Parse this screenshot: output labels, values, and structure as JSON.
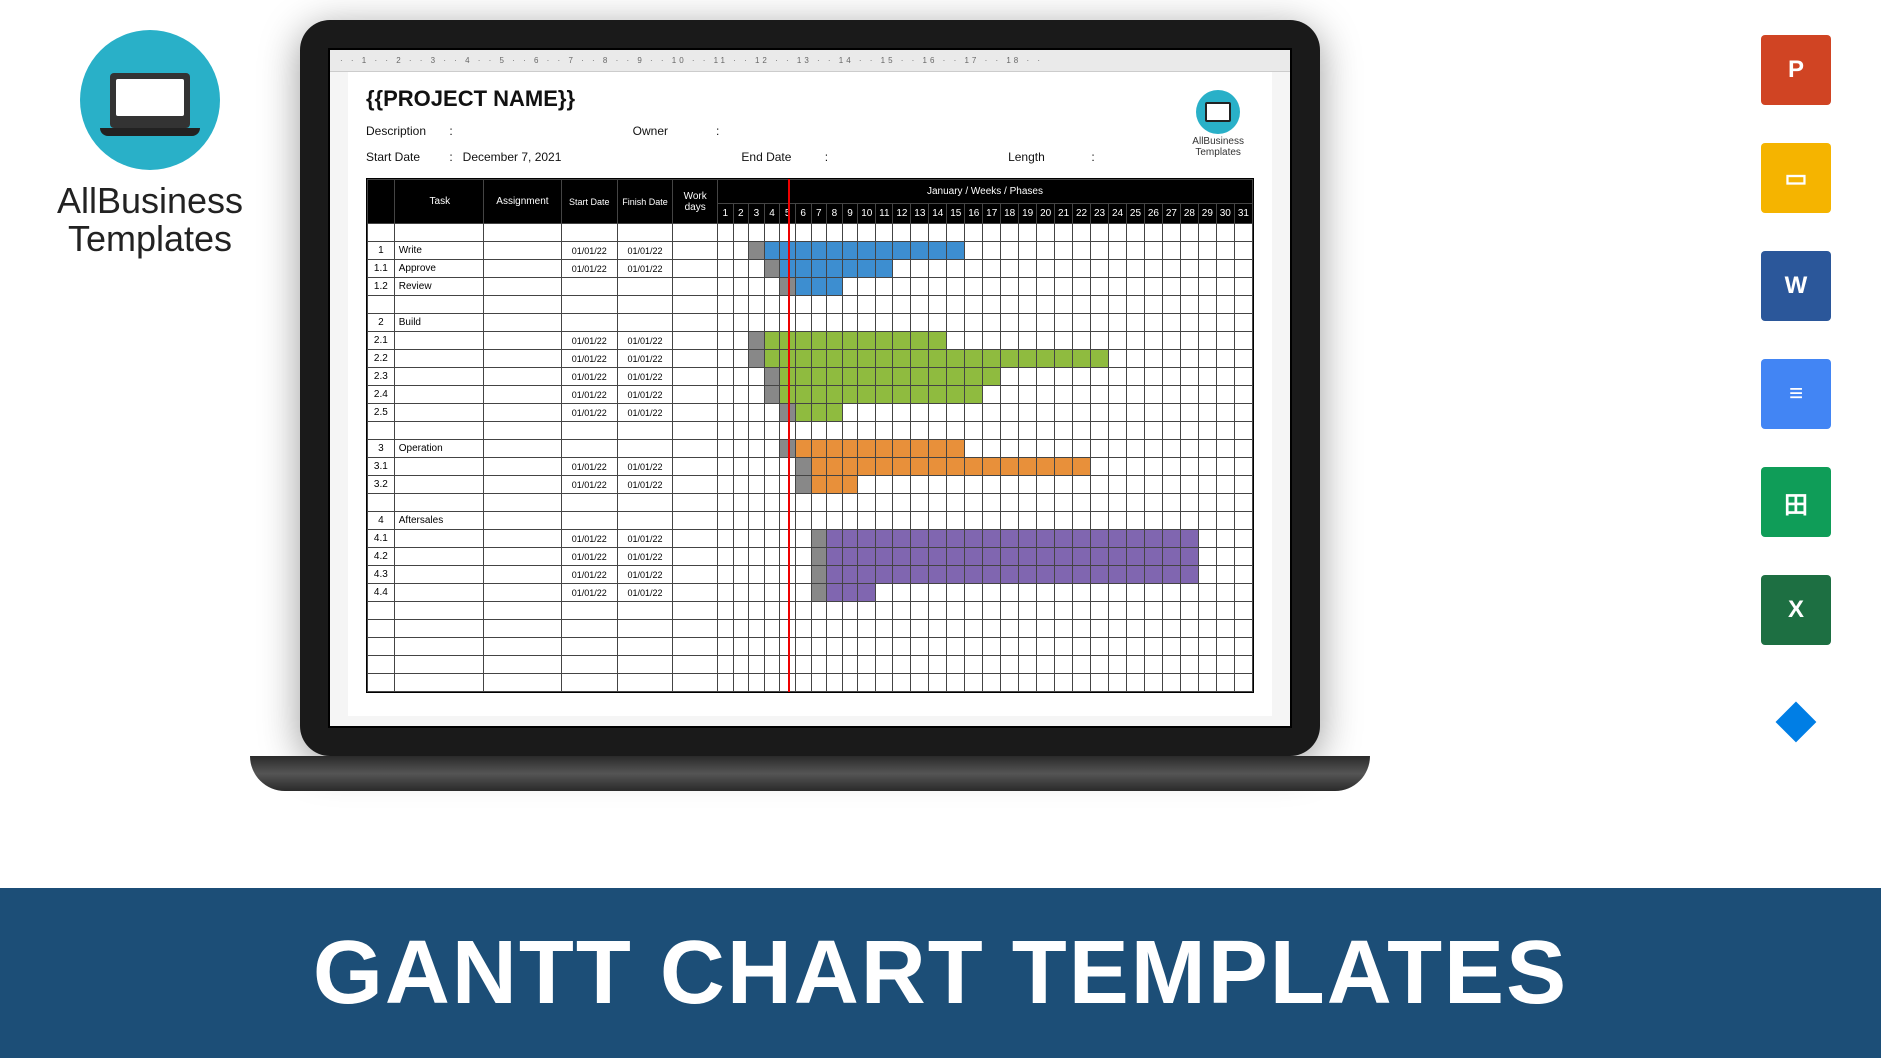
{
  "brand": {
    "line1": "AllBusiness",
    "line2": "Templates"
  },
  "icons": {
    "powerpoint": "P",
    "slides": "▭",
    "word": "W",
    "docs": "≡",
    "sheets": "田",
    "excel": "X",
    "dropbox": "⬥"
  },
  "doc": {
    "title": "{{PROJECT NAME}}",
    "desc_label": "Description",
    "owner_label": "Owner",
    "start_label": "Start Date",
    "start_value": "December 7, 2021",
    "end_label": "End Date",
    "length_label": "Length",
    "watermark": "AllBusiness\nTemplates"
  },
  "headers": {
    "task": "Task",
    "assignment": "Assignment",
    "start": "Start Date",
    "finish": "Finish Date",
    "work": "Work days",
    "timeline": "January / Weeks / Phases"
  },
  "banner": "GANTT CHART TEMPLATES",
  "today": 7,
  "chart_data": {
    "type": "gantt",
    "title": "{{PROJECT NAME}}",
    "xlabel": "January / Weeks / Phases",
    "x_range": [
      1,
      31
    ],
    "today_marker": 7,
    "color_legend": {
      "Write": "#3d8ed0",
      "Build": "#8fbb3f",
      "Operation": "#e8903a",
      "Aftersales": "#8066b0",
      "lead": "#888"
    },
    "rows": [
      {
        "id": "",
        "task": "",
        "start_date": "",
        "finish_date": "",
        "bar": null
      },
      {
        "id": "1",
        "task": "Write",
        "start_date": "01/01/22",
        "finish_date": "01/01/22",
        "bar": {
          "color": "blue",
          "start": 4,
          "end": 15,
          "lead": 1
        }
      },
      {
        "id": "1.1",
        "task": "Approve",
        "start_date": "01/01/22",
        "finish_date": "01/01/22",
        "bar": {
          "color": "blue",
          "start": 5,
          "end": 11,
          "lead": 1
        }
      },
      {
        "id": "1.2",
        "task": "Review",
        "start_date": "",
        "finish_date": "",
        "bar": {
          "color": "blue",
          "start": 6,
          "end": 8,
          "lead": 1
        }
      },
      {
        "id": "",
        "task": "",
        "start_date": "",
        "finish_date": "",
        "bar": null
      },
      {
        "id": "2",
        "task": "Build",
        "start_date": "",
        "finish_date": "",
        "bar": null
      },
      {
        "id": "2.1",
        "task": "",
        "start_date": "01/01/22",
        "finish_date": "01/01/22",
        "bar": {
          "color": "green",
          "start": 4,
          "end": 14,
          "lead": 1
        }
      },
      {
        "id": "2.2",
        "task": "",
        "start_date": "01/01/22",
        "finish_date": "01/01/22",
        "bar": {
          "color": "green",
          "start": 4,
          "end": 23,
          "lead": 1
        }
      },
      {
        "id": "2.3",
        "task": "",
        "start_date": "01/01/22",
        "finish_date": "01/01/22",
        "bar": {
          "color": "green",
          "start": 5,
          "end": 17,
          "lead": 1
        }
      },
      {
        "id": "2.4",
        "task": "",
        "start_date": "01/01/22",
        "finish_date": "01/01/22",
        "bar": {
          "color": "green",
          "start": 5,
          "end": 16,
          "lead": 1
        }
      },
      {
        "id": "2.5",
        "task": "",
        "start_date": "01/01/22",
        "finish_date": "01/01/22",
        "bar": {
          "color": "green",
          "start": 6,
          "end": 8,
          "lead": 1
        }
      },
      {
        "id": "",
        "task": "",
        "start_date": "",
        "finish_date": "",
        "bar": null
      },
      {
        "id": "3",
        "task": "Operation",
        "start_date": "",
        "finish_date": "",
        "bar": {
          "color": "orange",
          "start": 6,
          "end": 15,
          "lead": 1
        }
      },
      {
        "id": "3.1",
        "task": "",
        "start_date": "01/01/22",
        "finish_date": "01/01/22",
        "bar": {
          "color": "orange",
          "start": 7,
          "end": 22,
          "lead": 1
        }
      },
      {
        "id": "3.2",
        "task": "",
        "start_date": "01/01/22",
        "finish_date": "01/01/22",
        "bar": {
          "color": "orange",
          "start": 7,
          "end": 9,
          "lead": 1
        }
      },
      {
        "id": "",
        "task": "",
        "start_date": "",
        "finish_date": "",
        "bar": null
      },
      {
        "id": "4",
        "task": "Aftersales",
        "start_date": "",
        "finish_date": "",
        "bar": null
      },
      {
        "id": "4.1",
        "task": "",
        "start_date": "01/01/22",
        "finish_date": "01/01/22",
        "bar": {
          "color": "purple",
          "start": 8,
          "end": 28,
          "lead": 1
        }
      },
      {
        "id": "4.2",
        "task": "",
        "start_date": "01/01/22",
        "finish_date": "01/01/22",
        "bar": {
          "color": "purple",
          "start": 8,
          "end": 28,
          "lead": 1
        }
      },
      {
        "id": "4.3",
        "task": "",
        "start_date": "01/01/22",
        "finish_date": "01/01/22",
        "bar": {
          "color": "purple",
          "start": 8,
          "end": 28,
          "lead": 1
        }
      },
      {
        "id": "4.4",
        "task": "",
        "start_date": "01/01/22",
        "finish_date": "01/01/22",
        "bar": {
          "color": "purple",
          "start": 8,
          "end": 10,
          "lead": 1
        }
      },
      {
        "id": "",
        "task": "",
        "start_date": "",
        "finish_date": "",
        "bar": null
      },
      {
        "id": "",
        "task": "",
        "start_date": "",
        "finish_date": "",
        "bar": null
      },
      {
        "id": "",
        "task": "",
        "start_date": "",
        "finish_date": "",
        "bar": null
      },
      {
        "id": "",
        "task": "",
        "start_date": "",
        "finish_date": "",
        "bar": null
      },
      {
        "id": "",
        "task": "",
        "start_date": "",
        "finish_date": "",
        "bar": null
      }
    ]
  }
}
